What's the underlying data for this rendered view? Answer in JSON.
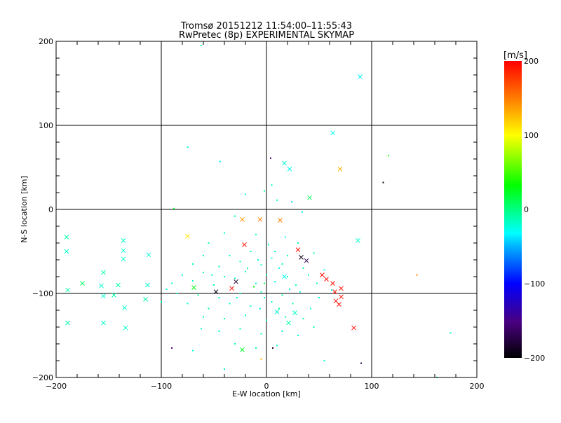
{
  "chart_data": {
    "type": "scatter",
    "title": "Tromsø 20151212 11:54:00–11:55:43",
    "subtitle": "RwPretec (8p) EXPERIMENTAL SKYMAP",
    "xlabel": "E-W location [km]",
    "ylabel": "N-S location [km]",
    "xlim": [
      -200,
      200
    ],
    "ylim": [
      -200,
      200
    ],
    "xticks": [
      "−200",
      "−100",
      "0",
      "100",
      "200"
    ],
    "yticks": [
      "−200",
      "−100",
      "0",
      "100",
      "200"
    ],
    "grid_values": [
      -100,
      0,
      100
    ],
    "colorbar": {
      "label": "[m/s]",
      "range": [
        -200,
        200
      ],
      "ticks": [
        "200",
        "100",
        "0",
        "−100",
        "−200"
      ]
    },
    "crosses": [
      [
        89,
        158,
        -30
      ],
      [
        63,
        91,
        -30
      ],
      [
        17,
        55,
        -20
      ],
      [
        22,
        48,
        -30
      ],
      [
        70,
        48,
        130
      ],
      [
        41,
        14,
        10
      ],
      [
        -23,
        -12,
        140
      ],
      [
        -6,
        -12,
        150
      ],
      [
        13,
        -13,
        150
      ],
      [
        -75,
        -32,
        110
      ],
      [
        -190,
        -33,
        -10
      ],
      [
        -136,
        -37,
        -20
      ],
      [
        -190,
        -50,
        -20
      ],
      [
        -136,
        -49,
        -20
      ],
      [
        -136,
        -59,
        -20
      ],
      [
        -112,
        -54,
        -20
      ],
      [
        87,
        -37,
        -20
      ],
      [
        30,
        -48,
        195
      ],
      [
        33,
        -57,
        -190
      ],
      [
        38,
        -61,
        -170
      ],
      [
        -21,
        -42,
        190
      ],
      [
        -155,
        -75,
        -10
      ],
      [
        -175,
        -88,
        10
      ],
      [
        -157,
        -91,
        -20
      ],
      [
        -141,
        -90,
        -10
      ],
      [
        -113,
        -90,
        -20
      ],
      [
        -189,
        -96,
        -10
      ],
      [
        53,
        -78,
        195
      ],
      [
        57,
        -83,
        195
      ],
      [
        63,
        -88,
        195
      ],
      [
        71,
        -94,
        195
      ],
      [
        71,
        -104,
        195
      ],
      [
        65,
        -98,
        195
      ],
      [
        66,
        -109,
        195
      ],
      [
        69,
        -113,
        195
      ],
      [
        -33,
        -94,
        195
      ],
      [
        -48,
        -98,
        -190
      ],
      [
        -29,
        -86,
        -180
      ],
      [
        -155,
        -103,
        -20
      ],
      [
        -145,
        -102,
        -10
      ],
      [
        -115,
        -107,
        -10
      ],
      [
        -135,
        -117,
        -20
      ],
      [
        -189,
        -135,
        -10
      ],
      [
        -155,
        -135,
        -20
      ],
      [
        -134,
        -141,
        -20
      ],
      [
        83,
        -141,
        195
      ],
      [
        -23,
        -167,
        20
      ],
      [
        -69,
        -93,
        30
      ],
      [
        17,
        -80,
        -30
      ],
      [
        27,
        -123,
        -20
      ],
      [
        21,
        -135,
        -10
      ],
      [
        10,
        -122,
        -20
      ]
    ],
    "dots": [
      [
        116,
        64,
        30
      ],
      [
        111,
        32,
        -195
      ],
      [
        -75,
        74,
        -20
      ],
      [
        4,
        61,
        -150
      ],
      [
        -44,
        57,
        -30
      ],
      [
        -62,
        195,
        -10
      ],
      [
        -88,
        1,
        20
      ],
      [
        5,
        29,
        -20
      ],
      [
        -20,
        18,
        -30
      ],
      [
        -2,
        22,
        -10
      ],
      [
        10,
        11,
        -20
      ],
      [
        24,
        9,
        -40
      ],
      [
        34,
        -3,
        -20
      ],
      [
        -30,
        -8,
        -10
      ],
      [
        -40,
        -28,
        -20
      ],
      [
        -10,
        -30,
        -20
      ],
      [
        18,
        -33,
        -30
      ],
      [
        -55,
        -40,
        -10
      ],
      [
        2,
        -42,
        -20
      ],
      [
        30,
        -40,
        -10
      ],
      [
        -60,
        -55,
        -20
      ],
      [
        -35,
        -55,
        -20
      ],
      [
        -15,
        -50,
        -10
      ],
      [
        5,
        -58,
        -30
      ],
      [
        20,
        -55,
        -20
      ],
      [
        45,
        -52,
        -10
      ],
      [
        -70,
        -65,
        -20
      ],
      [
        -45,
        -68,
        -10
      ],
      [
        -25,
        -62,
        -20
      ],
      [
        -5,
        -66,
        -20
      ],
      [
        12,
        -70,
        -30
      ],
      [
        35,
        -70,
        -10
      ],
      [
        -80,
        -78,
        -20
      ],
      [
        -60,
        -75,
        -10
      ],
      [
        -40,
        -80,
        -20
      ],
      [
        -20,
        -74,
        -20
      ],
      [
        0,
        -78,
        -20
      ],
      [
        20,
        -80,
        -10
      ],
      [
        40,
        -78,
        -20
      ],
      [
        55,
        -72,
        -30
      ],
      [
        -90,
        -88,
        -20
      ],
      [
        -70,
        -85,
        -20
      ],
      [
        -50,
        -90,
        -10
      ],
      [
        -30,
        -82,
        -20
      ],
      [
        -10,
        -88,
        -20
      ],
      [
        8,
        -86,
        -30
      ],
      [
        28,
        -90,
        -20
      ],
      [
        48,
        -88,
        -10
      ],
      [
        -85,
        -100,
        -20
      ],
      [
        -65,
        -102,
        -10
      ],
      [
        -45,
        -105,
        -20
      ],
      [
        -25,
        -100,
        -20
      ],
      [
        -5,
        -98,
        -20
      ],
      [
        15,
        -102,
        -10
      ],
      [
        32,
        -98,
        -20
      ],
      [
        50,
        -105,
        -20
      ],
      [
        -75,
        -112,
        -20
      ],
      [
        -55,
        -118,
        -10
      ],
      [
        -35,
        -112,
        -20
      ],
      [
        -15,
        -115,
        -20
      ],
      [
        5,
        -110,
        -20
      ],
      [
        25,
        -112,
        -10
      ],
      [
        42,
        -118,
        -20
      ],
      [
        -60,
        -128,
        -20
      ],
      [
        -40,
        -130,
        -10
      ],
      [
        -20,
        -126,
        -20
      ],
      [
        0,
        -132,
        -20
      ],
      [
        18,
        -128,
        -20
      ],
      [
        35,
        -130,
        -10
      ],
      [
        -45,
        -145,
        -20
      ],
      [
        -25,
        -142,
        -20
      ],
      [
        -5,
        -148,
        -10
      ],
      [
        15,
        -145,
        -20
      ],
      [
        30,
        -150,
        -20
      ],
      [
        -30,
        -160,
        -20
      ],
      [
        -10,
        -165,
        -10
      ],
      [
        10,
        -162,
        -20
      ],
      [
        55,
        -180,
        -20
      ],
      [
        -90,
        -165,
        -150
      ],
      [
        -70,
        -168,
        -20
      ],
      [
        6,
        -165,
        -190
      ],
      [
        -40,
        -190,
        -20
      ],
      [
        -5,
        -178,
        130
      ],
      [
        90,
        -183,
        -170
      ],
      [
        143,
        -78,
        150
      ],
      [
        175,
        -147,
        -20
      ],
      [
        162,
        -200,
        -20
      ],
      [
        -2,
        -88,
        10
      ],
      [
        -12,
        -92,
        30
      ],
      [
        -18,
        -70,
        -10
      ],
      [
        -8,
        -60,
        -20
      ],
      [
        8,
        -50,
        -20
      ],
      [
        15,
        -65,
        -20
      ],
      [
        22,
        -95,
        -20
      ],
      [
        -28,
        -105,
        -20
      ],
      [
        -52,
        -78,
        -20
      ],
      [
        -95,
        -95,
        -20
      ],
      [
        -100,
        -110,
        -10
      ],
      [
        62,
        -96,
        -30
      ],
      [
        45,
        -140,
        -10
      ],
      [
        -62,
        -142,
        -20
      ],
      [
        -2,
        -105,
        -30
      ],
      [
        -6,
        -118,
        -20
      ],
      [
        12,
        -118,
        -10
      ]
    ]
  }
}
